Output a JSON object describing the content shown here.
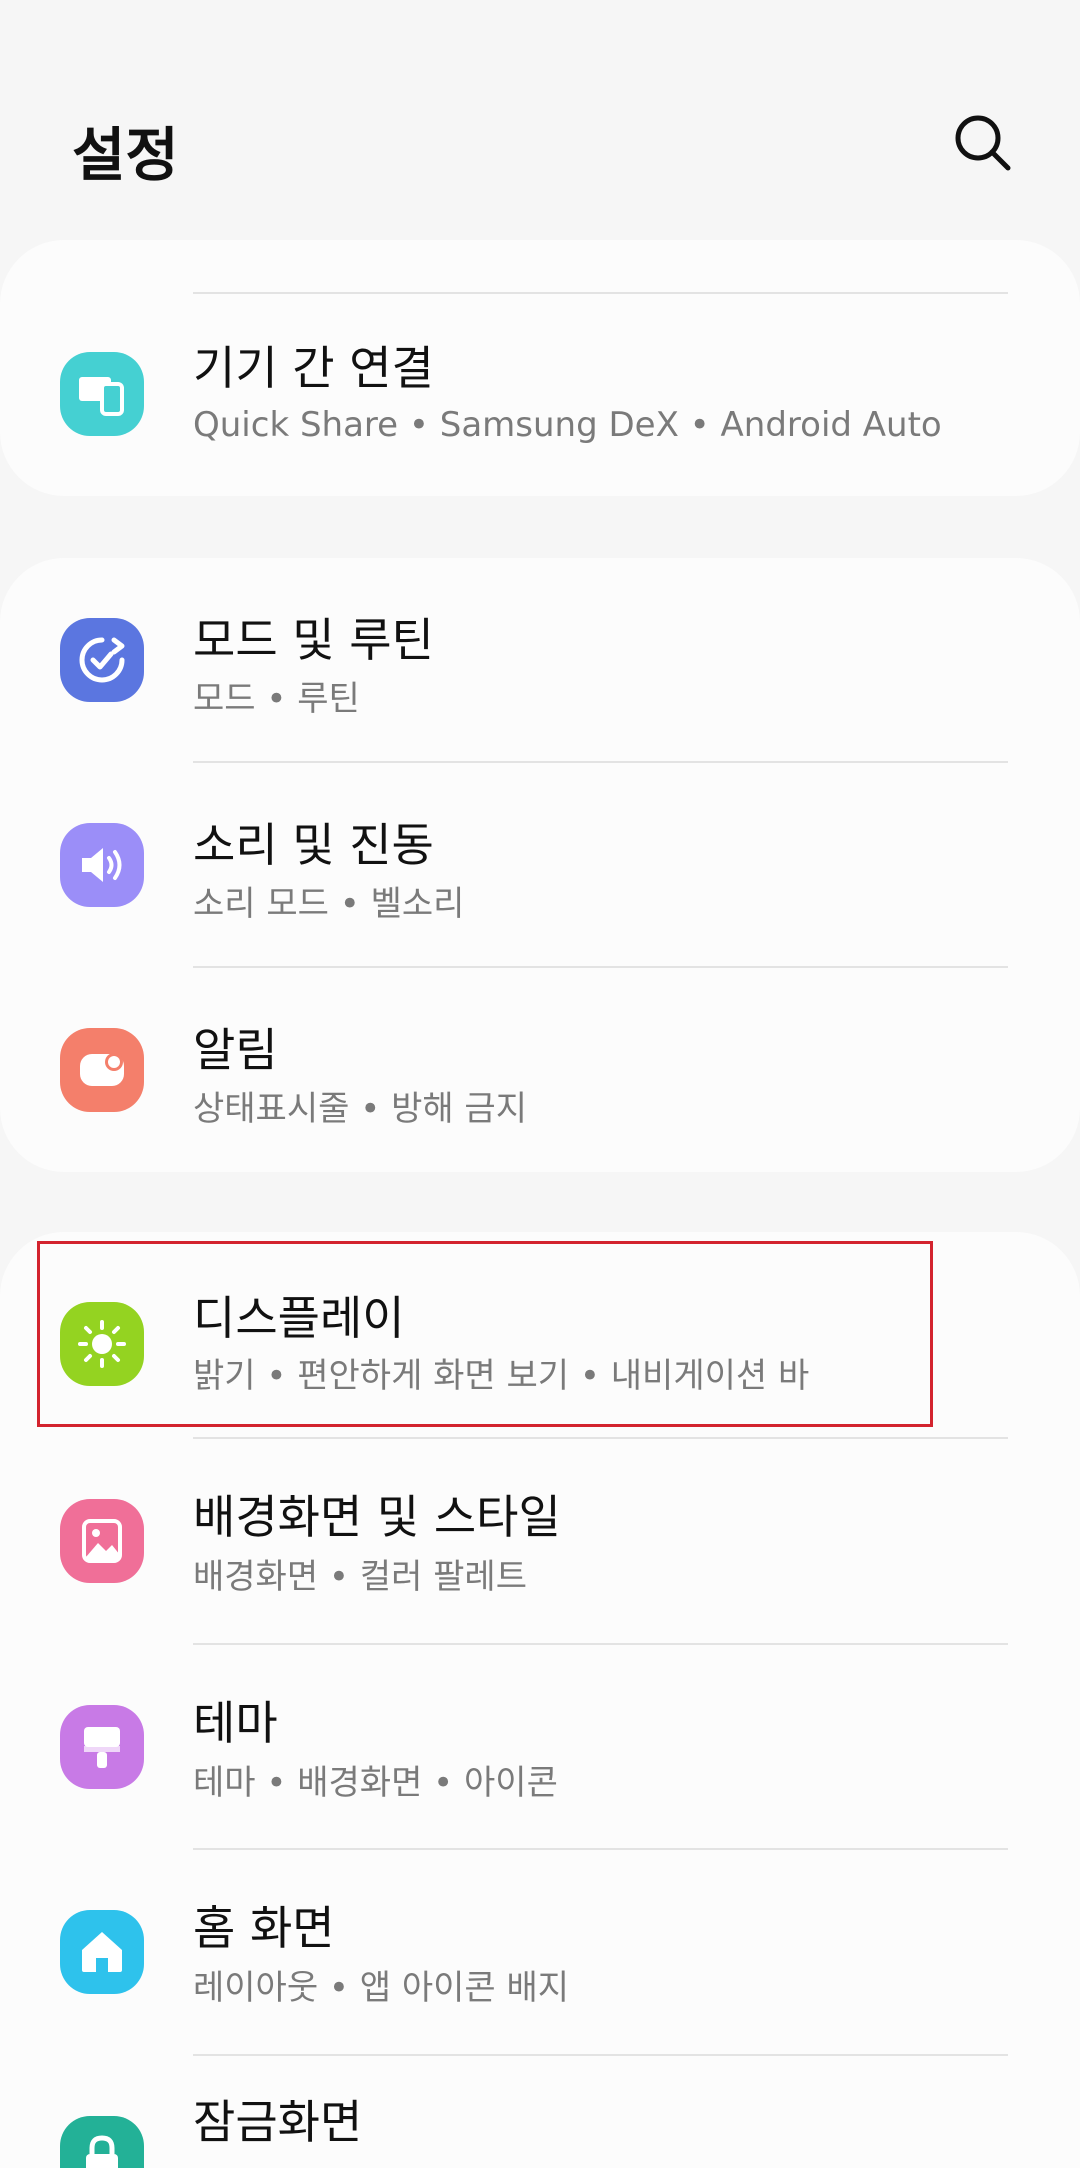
{
  "header": {
    "title": "설정",
    "search_icon": "search-icon"
  },
  "cards": [
    {
      "items": [
        {
          "key": "connected-devices",
          "title": "기기 간 연결",
          "subtitle": "Quick Share • Samsung DeX • Android Auto",
          "icon": "devices-icon",
          "color": "#45d0d2"
        }
      ]
    },
    {
      "items": [
        {
          "key": "modes-routines",
          "title": "모드 및 루틴",
          "subtitle": "모드 • 루틴",
          "icon": "routine-check-icon",
          "color": "#5b76e0"
        },
        {
          "key": "sounds-vibration",
          "title": "소리 및 진동",
          "subtitle": "소리 모드 • 벨소리",
          "icon": "speaker-icon",
          "color": "#9b8ef8"
        },
        {
          "key": "notifications",
          "title": "알림",
          "subtitle": "상태표시줄 • 방해 금지",
          "icon": "notification-icon",
          "color": "#f47f6b"
        }
      ]
    },
    {
      "items": [
        {
          "key": "display",
          "title": "디스플레이",
          "subtitle": "밝기 • 편안하게 화면 보기 • 내비게이션 바",
          "icon": "sun-icon",
          "color": "#94d321"
        },
        {
          "key": "wallpaper-style",
          "title": "배경화면 및 스타일",
          "subtitle": "배경화면 • 컬러 팔레트",
          "icon": "image-icon",
          "color": "#f06f98"
        },
        {
          "key": "themes",
          "title": "테마",
          "subtitle": "테마 • 배경화면 • 아이콘",
          "icon": "brush-icon",
          "color": "#c87ae6"
        },
        {
          "key": "home-screen",
          "title": "홈 화면",
          "subtitle": "레이아웃 • 앱 아이콘 배지",
          "icon": "home-icon",
          "color": "#2ec2ec"
        },
        {
          "key": "lock-screen",
          "title": "잠금화면",
          "subtitle": "",
          "icon": "lock-icon",
          "color": "#23b197"
        }
      ]
    }
  ],
  "highlight_color": "#d3232e"
}
